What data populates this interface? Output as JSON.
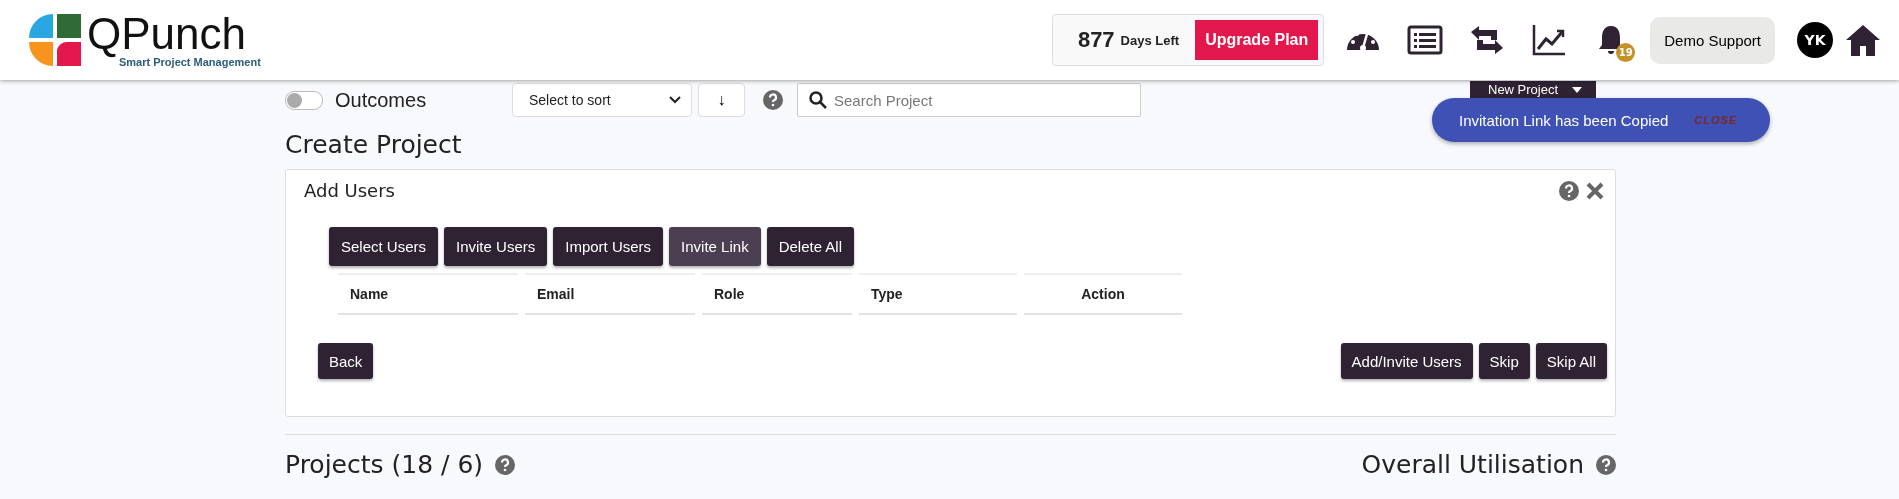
{
  "header": {
    "logo": {
      "name": "QPunch",
      "tagline": "Smart Project Management"
    },
    "days_left": {
      "count": "877",
      "label": "Days Left"
    },
    "upgrade_button": "Upgrade Plan",
    "notifications": {
      "count": "19"
    },
    "user_button": "Demo Support",
    "avatar": "YK"
  },
  "toolbar": {
    "outcomes_toggle": {
      "label": "Outcomes",
      "on": false
    },
    "sort_select": {
      "value": "Select to sort"
    },
    "sort_direction": "↓",
    "search": {
      "placeholder": "Search Project"
    },
    "new_project_button": "New Project"
  },
  "toast": {
    "message": "Invitation Link has been Copied",
    "action": "CLOSE"
  },
  "create_project": {
    "title": "Create Project",
    "panel_title": "Add Users",
    "tabs": [
      {
        "label": "Select Users",
        "selected": false
      },
      {
        "label": "Invite Users",
        "selected": false
      },
      {
        "label": "Import Users",
        "selected": false
      },
      {
        "label": "Invite Link",
        "selected": true
      },
      {
        "label": "Delete All",
        "selected": false
      }
    ],
    "table": {
      "columns": [
        "Name",
        "Email",
        "Role",
        "Type",
        "Action"
      ]
    },
    "back_button": "Back",
    "actions": [
      "Add/Invite Users",
      "Skip",
      "Skip All"
    ]
  },
  "projects": {
    "title": "Projects (18 / 6)",
    "utilisation_title": "Overall Utilisation"
  }
}
